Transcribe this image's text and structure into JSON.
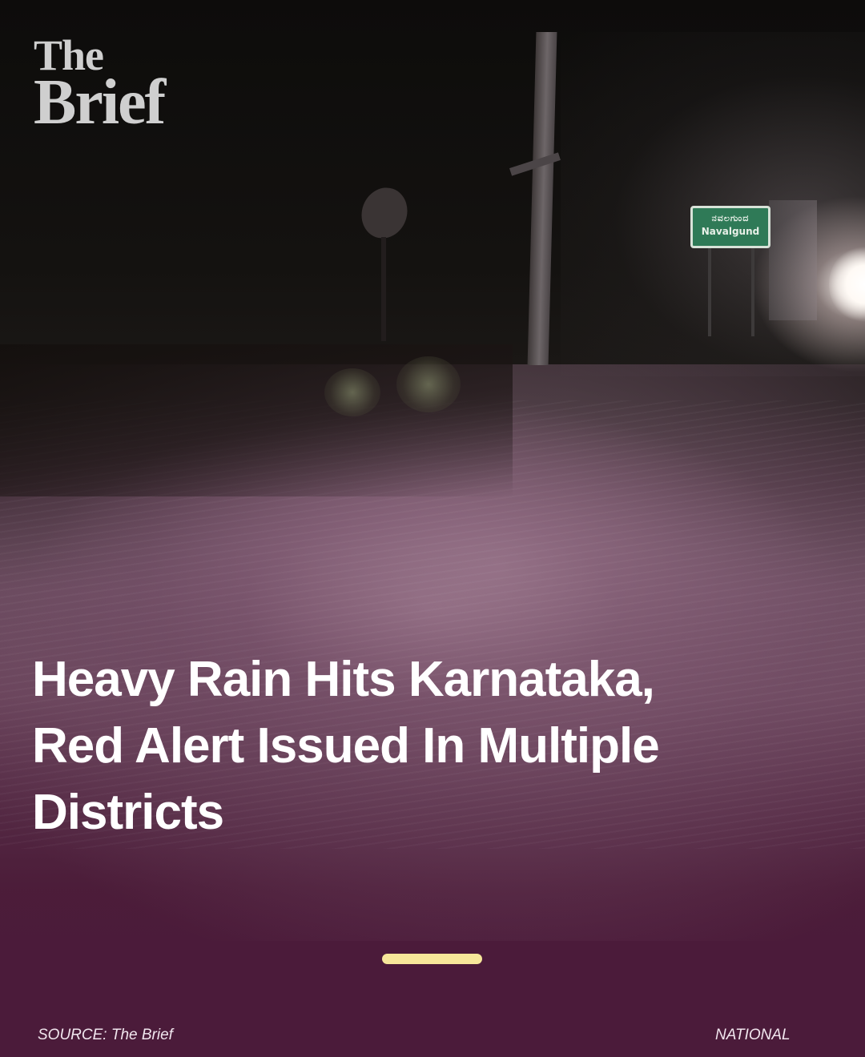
{
  "brand": {
    "line1": "The",
    "line2": "Brief"
  },
  "photo": {
    "sign_kannada": "ನವಲಗುಂದ",
    "sign_english": "Navalgund"
  },
  "headline": "Heavy Rain Hits Karnataka, Red Alert Issued In Multiple Districts",
  "carousel": {
    "active_index": 1,
    "total": 1
  },
  "footer": {
    "source": "SOURCE: The Brief",
    "category": "NATIONAL"
  },
  "colors": {
    "background": "#4b1b3a",
    "indicator": "#f7e79a",
    "headline_text": "#ffffff",
    "logo_text": "#cfcfcf"
  }
}
